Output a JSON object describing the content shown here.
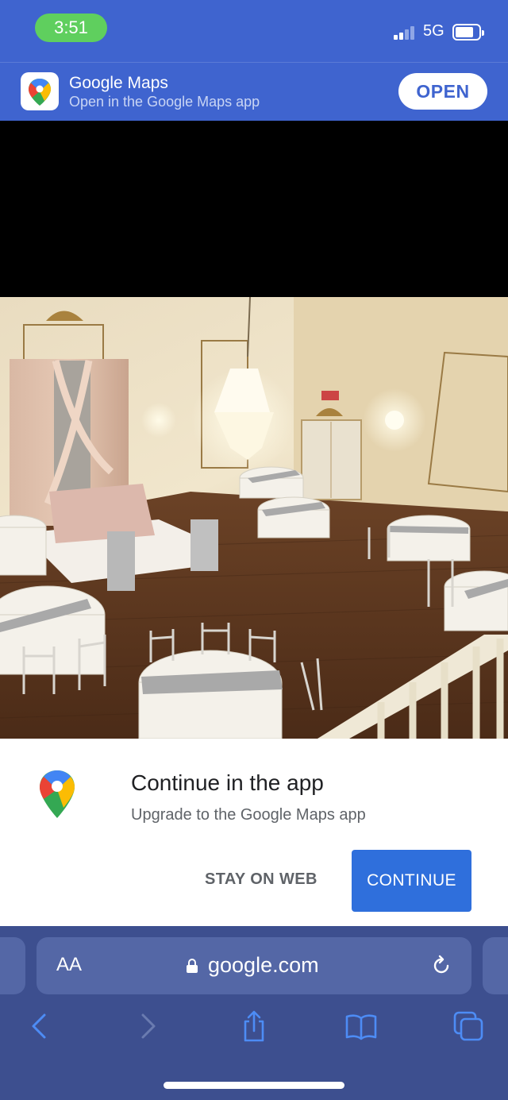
{
  "status_bar": {
    "time": "3:51",
    "network": "5G",
    "time_pill_color": "#5fcf5e"
  },
  "app_banner": {
    "title": "Google Maps",
    "subtitle": "Open in the Google Maps app",
    "open_label": "OPEN",
    "icon": "google-maps-pin-icon",
    "background": "#3f64cf"
  },
  "photo": {
    "icon": "banquet-hall-photo"
  },
  "sheet": {
    "title": "Continue in the app",
    "subtitle": "Upgrade to the Google Maps app",
    "stay_label": "STAY ON WEB",
    "continue_label": "CONTINUE",
    "accent": "#2f6fdc"
  },
  "browser": {
    "aa_label": "AA",
    "url": "google.com",
    "icons": [
      "back-icon",
      "forward-icon",
      "share-icon",
      "bookmarks-icon",
      "tabs-icon",
      "reload-icon",
      "lock-icon"
    ]
  }
}
